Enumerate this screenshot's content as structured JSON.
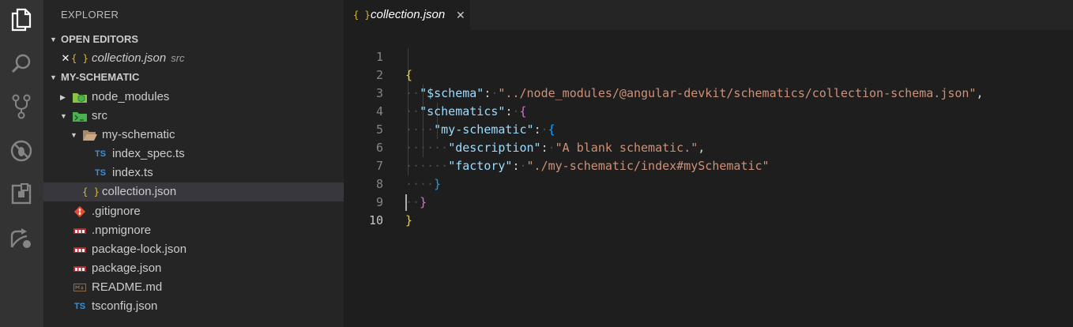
{
  "sidebar": {
    "title": "EXPLORER",
    "open_editors": {
      "label": "OPEN EDITORS",
      "items": [
        {
          "close": "✕",
          "icon": "{ }",
          "name": "collection.json",
          "hint": "src"
        }
      ]
    },
    "project": {
      "label": "MY-SCHEMATIC",
      "files": [
        {
          "name": "node_modules",
          "icon": "node-folder-icon"
        },
        {
          "name": "src",
          "icon": "src-folder-icon"
        },
        {
          "name": "my-schematic",
          "icon": "folder-open-icon"
        },
        {
          "name": "index_spec.ts",
          "icon": "TS"
        },
        {
          "name": "index.ts",
          "icon": "TS"
        },
        {
          "name": "collection.json",
          "icon": "{ }"
        },
        {
          "name": ".gitignore",
          "icon": "git-icon"
        },
        {
          "name": ".npmignore",
          "icon": "npm-icon"
        },
        {
          "name": "package-lock.json",
          "icon": "npm-icon"
        },
        {
          "name": "package.json",
          "icon": "npm-icon"
        },
        {
          "name": "README.md",
          "icon": "markdown-icon"
        },
        {
          "name": "tsconfig.json",
          "icon": "TS"
        }
      ]
    }
  },
  "editor": {
    "tab": {
      "icon": "{ }",
      "label": "collection.json",
      "close": "✕"
    },
    "line_numbers": [
      "1",
      "2",
      "3",
      "4",
      "5",
      "6",
      "7",
      "8",
      "9",
      "10"
    ],
    "code": {
      "l1_open": "{",
      "l2_key": "\"$schema\"",
      "l2_colon": ":",
      "l2_val": "\"../node_modules/@angular-devkit/schematics/collection-schema.json\"",
      "l2_comma": ",",
      "l3_key": "\"schematics\"",
      "l3_colon": ":",
      "l3_open": "{",
      "l4_key": "\"my-schematic\"",
      "l4_colon": ":",
      "l4_open": "{",
      "l5_key": "\"description\"",
      "l5_colon": ":",
      "l5_val": "\"A blank schematic.\"",
      "l5_comma": ",",
      "l6_key": "\"factory\"",
      "l6_colon": ":",
      "l6_val": "\"./my-schematic/index#mySchematic\"",
      "l7_close": "}",
      "l8_close": "}",
      "l9_close": "}"
    }
  },
  "colors": {
    "activity_bar": "#333333",
    "sidebar": "#252526",
    "editor": "#1e1e1e",
    "json_key": "#9cdcfe",
    "json_string": "#ce9178",
    "bracket_level1": "#ffd700",
    "bracket_level2": "#da70d6",
    "bracket_level3": "#179fff"
  }
}
